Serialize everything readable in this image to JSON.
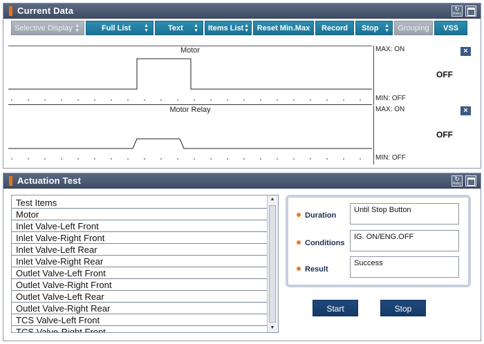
{
  "current_data": {
    "title": "Current Data",
    "retry_label": "Retry",
    "toolbar": {
      "selective_display": "Selective Display",
      "full_list": "Full List",
      "text": "Text",
      "items_list": "Items List",
      "reset_min_max": "Reset Min.Max",
      "record": "Record",
      "stop": "Stop",
      "grouping": "Grouping",
      "vss": "VSS"
    },
    "graphs": [
      {
        "name": "Motor",
        "max": "MAX: ON",
        "value": "OFF",
        "min": "MIN: OFF"
      },
      {
        "name": "Motor Relay",
        "max": "MAX: ON",
        "value": "OFF",
        "min": "MIN: OFF"
      }
    ],
    "close_glyph": "×"
  },
  "actuation_test": {
    "title": "Actuation Test",
    "retry_label": "Retry",
    "list_header": "Test Items",
    "items": [
      "Motor",
      "Inlet Valve-Left Front",
      "Inlet Valve-Right Front",
      "Inlet Valve-Left Rear",
      "Inlet Valve-Right Rear",
      "Outlet Valve-Left Front",
      "Outlet Valve-Right Front",
      "Outlet Valve-Left Rear",
      "Outlet Valve-Right Rear",
      "TCS Valve-Left Front",
      "TCS Valve-Right Front"
    ],
    "duration_label": "Duration",
    "duration_value": "Until Stop Button",
    "conditions_label": "Conditions",
    "conditions_value": "IG. ON/ENG.OFF",
    "result_label": "Result",
    "result_value": "Success",
    "start_label": "Start",
    "stop_label": "Stop"
  },
  "colors": {
    "header": "#46546d",
    "toolbar_button": "#1f7ba1",
    "action_button": "#1a4576",
    "accent_dot": "#e87d1e"
  }
}
